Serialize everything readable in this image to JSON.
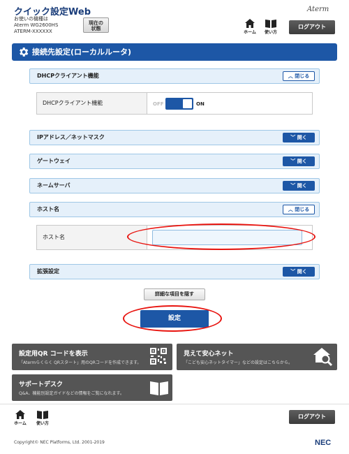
{
  "header": {
    "app_title": "クイック設定Web",
    "device_label": "お使いの機種は",
    "device_model": "Aterm WG2600HS",
    "device_name": "ATERM-XXXXXX",
    "status_button_line1": "現在の",
    "status_button_line2": "状態",
    "brand": "Aterm",
    "home_label": "ホーム",
    "help_label": "使い方",
    "logout_label": "ログアウト"
  },
  "page": {
    "title": "接続先設定(ローカルルータ)"
  },
  "sections": {
    "dhcp": {
      "label": "DHCPクライアント機能",
      "toggle_label": "閉じる"
    },
    "ip": {
      "label": "IPアドレス／ネットマスク",
      "toggle_label": "開く"
    },
    "gateway": {
      "label": "ゲートウェイ",
      "toggle_label": "開く"
    },
    "nameserver": {
      "label": "ネームサーバ",
      "toggle_label": "開く"
    },
    "hostname": {
      "label": "ホスト名",
      "toggle_label": "閉じる"
    },
    "extended": {
      "label": "拡張設定",
      "toggle_label": "開く"
    }
  },
  "dhcp_row": {
    "label": "DHCPクライアント機能",
    "off_label": "OFF",
    "on_label": "ON",
    "state": "on"
  },
  "hostname_row": {
    "label": "ホスト名",
    "value": ""
  },
  "buttons": {
    "hide_details": "詳細な項目を隠す",
    "submit": "設定"
  },
  "cards": {
    "qr": {
      "title": "設定用QR コードを表示",
      "desc": "「Atermらくらく QRスタート」用のQRコードを作成できます。"
    },
    "safe": {
      "title": "見えて安心ネット",
      "desc": "「こども安心ネットタイマー」などの設定はこちらから。"
    },
    "support": {
      "title": "サポートデスク",
      "desc": "Q&A、機能別設定ガイドなどの情報をご覧になれます。"
    }
  },
  "footer": {
    "home_label": "ホーム",
    "help_label": "使い方",
    "logout_label": "ログアウト",
    "copyright": "Copyright© NEC Platforms, Ltd. 2001-2019",
    "logo": "NEC"
  },
  "colors": {
    "primary": "#1d57a6",
    "section_bg": "#e5f0fa",
    "card_bg": "#555555",
    "highlight": "#e8140f"
  }
}
